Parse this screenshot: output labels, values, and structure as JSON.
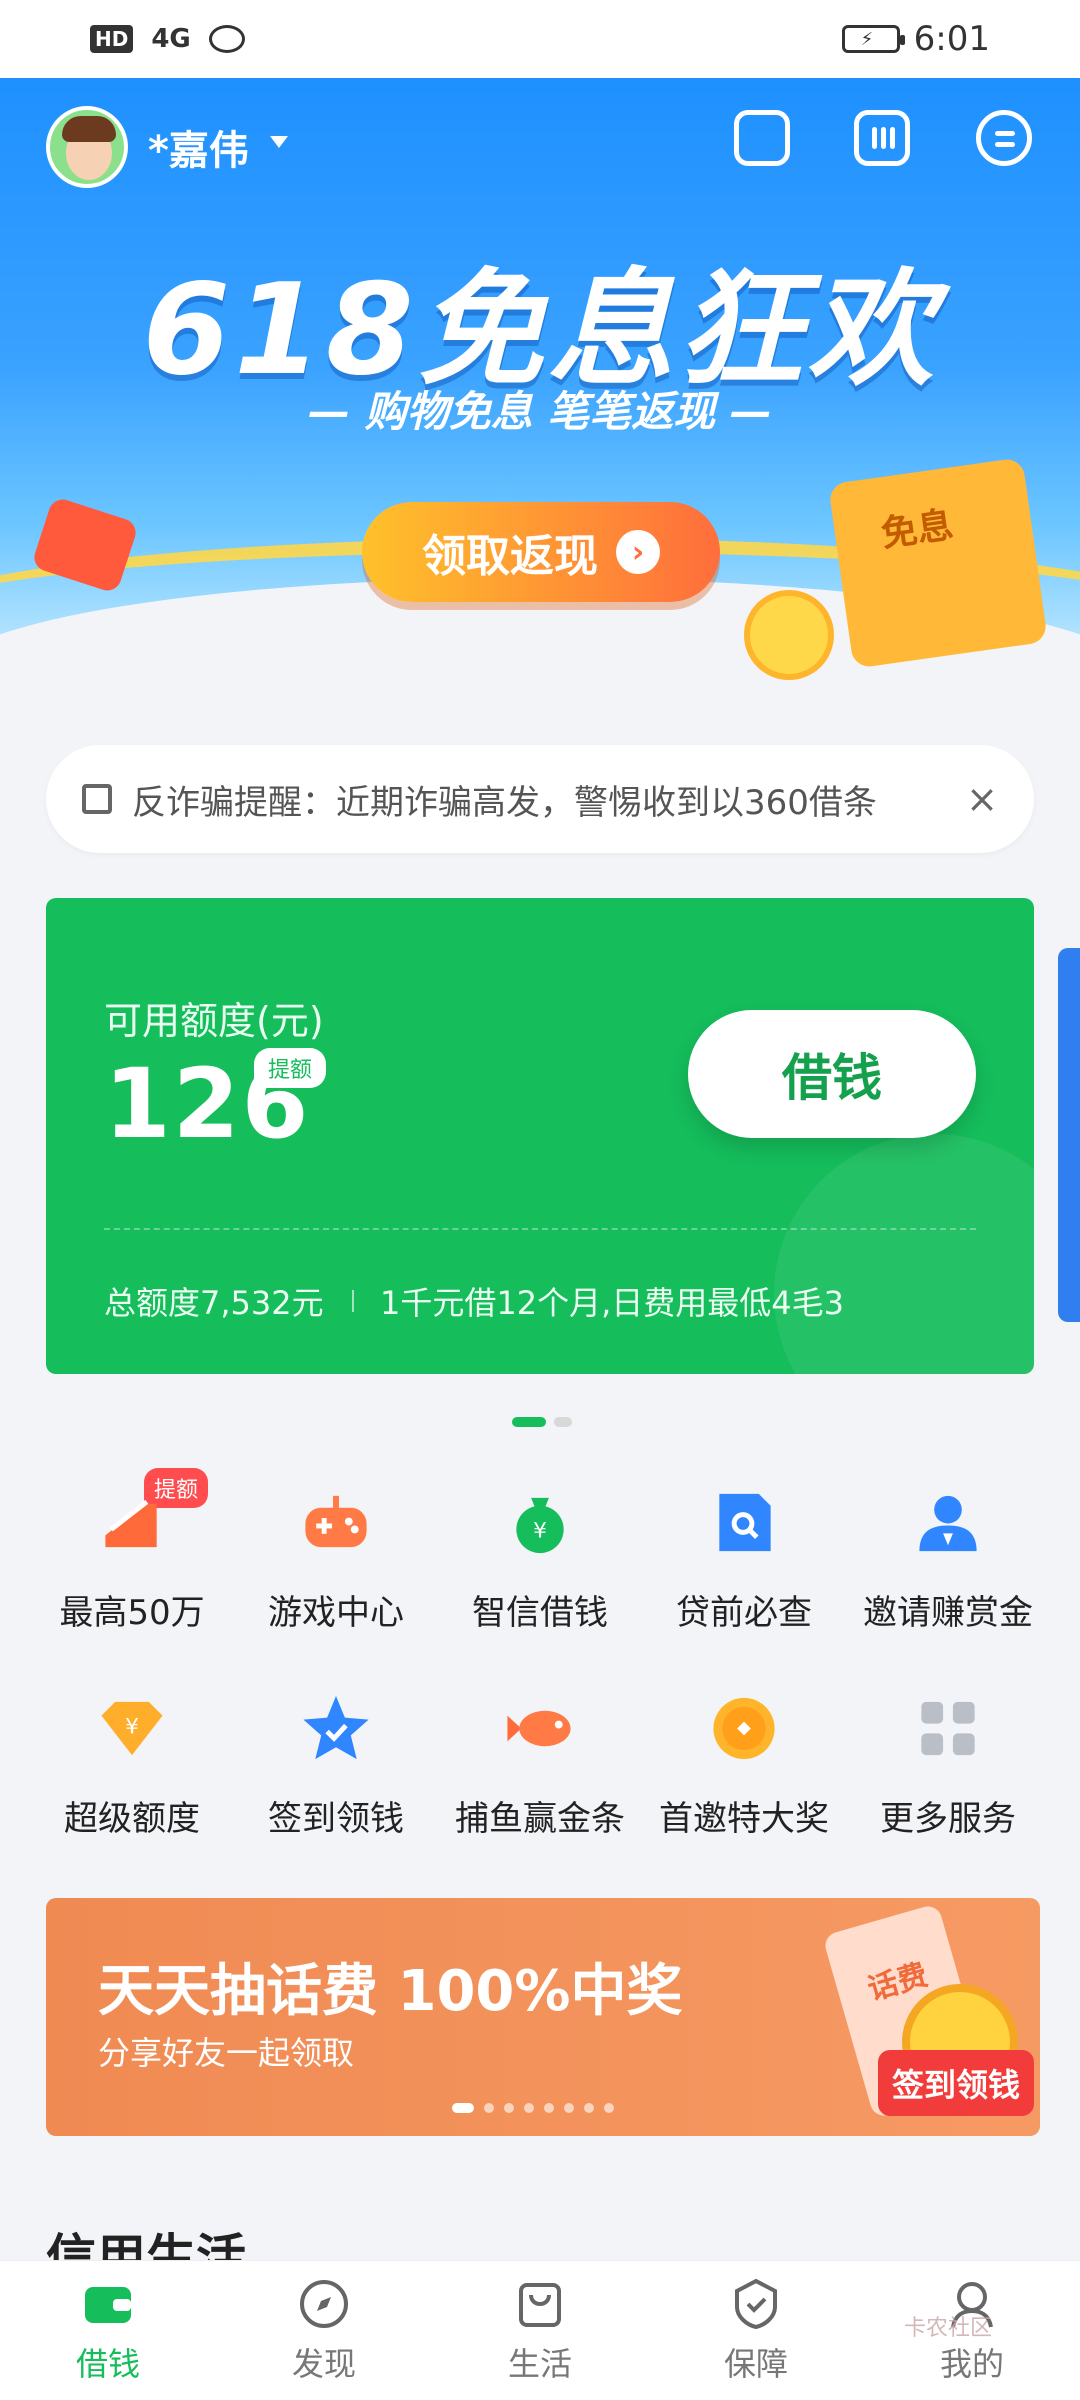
{
  "status_bar": {
    "network_badge": "HD",
    "signal": "4G",
    "time": "6:01"
  },
  "header": {
    "username": "*嘉伟"
  },
  "hero": {
    "title": "618免息狂欢",
    "subtitle": "— 购物免息 笔笔返现 —",
    "cta_label": "领取返现",
    "envelope_label": "免息"
  },
  "notice": {
    "text": "反诈骗提醒：近期诈骗高发，警惕收到以360借条",
    "close_label": "×"
  },
  "credit_card": {
    "available_label": "可用额度(元)",
    "available_amount": "126",
    "raise_tag": "提额",
    "borrow_label": "借钱",
    "total_label": "总额度7,532元",
    "terms": "1千元借12个月,日费用最低4毛3"
  },
  "services": [
    {
      "label": "最高50万",
      "icon": "chart-up-icon",
      "badge": "提额"
    },
    {
      "label": "游戏中心",
      "icon": "gamepad-icon"
    },
    {
      "label": "智信借钱",
      "icon": "money-bag-icon"
    },
    {
      "label": "贷前必查",
      "icon": "doc-search-icon"
    },
    {
      "label": "邀请赚赏金",
      "icon": "person-icon"
    },
    {
      "label": "超级额度",
      "icon": "diamond-yuan-icon"
    },
    {
      "label": "签到领钱",
      "icon": "star-check-icon"
    },
    {
      "label": "捕鱼赢金条",
      "icon": "fish-icon"
    },
    {
      "label": "首邀特大奖",
      "icon": "gold-coin-icon"
    },
    {
      "label": "更多服务",
      "icon": "grid-icon"
    }
  ],
  "banner": {
    "title": "天天抽话费 100%中奖",
    "subtitle": "分享好友一起领取",
    "sign_label": "签到领钱",
    "phone_label": "话费"
  },
  "section": {
    "title": "信用生活"
  },
  "bottom_nav": [
    {
      "label": "借钱",
      "icon": "wallet-icon",
      "active": true
    },
    {
      "label": "发现",
      "icon": "compass-icon"
    },
    {
      "label": "生活",
      "icon": "shopping-bag-icon"
    },
    {
      "label": "保障",
      "icon": "shield-check-icon"
    },
    {
      "label": "我的",
      "icon": "user-icon"
    }
  ],
  "watermark": "卡农社区",
  "colors": {
    "brand_green": "#15bd5b",
    "hero_blue": "#1e90ff",
    "banner_orange": "#f08a53"
  }
}
